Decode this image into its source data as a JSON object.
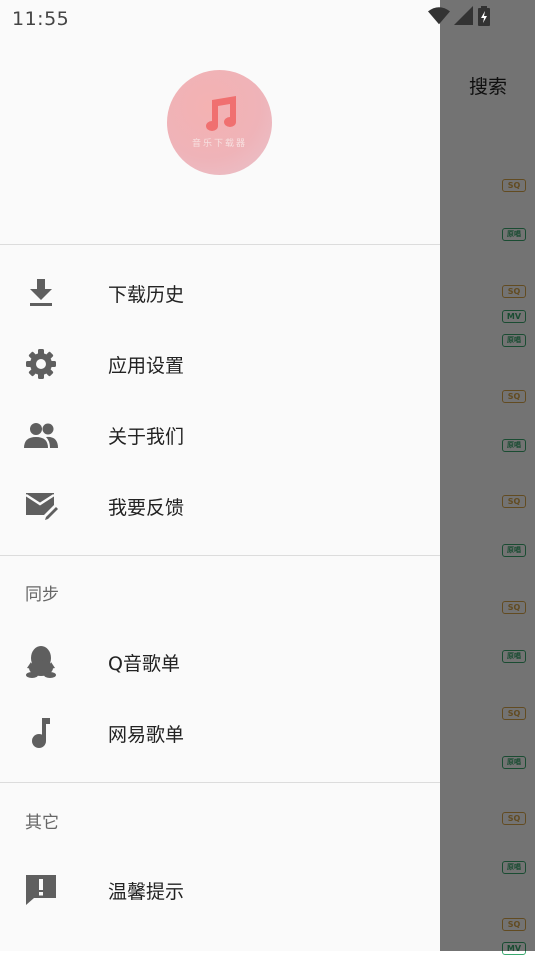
{
  "status_bar": {
    "time": "11:55"
  },
  "background_page": {
    "search_label": "搜索",
    "badges": [
      {
        "type": "sq",
        "text": "SQ"
      },
      {
        "type": "yc",
        "text": "原唱"
      },
      {
        "type": "sq",
        "text": "SQ"
      },
      {
        "type": "mv",
        "text": "MV"
      },
      {
        "type": "yc",
        "text": "原唱"
      },
      {
        "type": "sq",
        "text": "SQ"
      },
      {
        "type": "yc",
        "text": "原唱"
      },
      {
        "type": "sq",
        "text": "SQ"
      },
      {
        "type": "yc",
        "text": "原唱"
      },
      {
        "type": "sq",
        "text": "SQ"
      },
      {
        "type": "yc",
        "text": "原唱"
      },
      {
        "type": "sq",
        "text": "SQ"
      },
      {
        "type": "yc",
        "text": "原唱"
      },
      {
        "type": "sq",
        "text": "SQ"
      },
      {
        "type": "yc",
        "text": "原唱"
      },
      {
        "type": "sq",
        "text": "SQ"
      },
      {
        "type": "mv",
        "text": "MV"
      }
    ]
  },
  "drawer": {
    "logo_text": "音乐下载器",
    "menu": [
      {
        "label": "下载历史",
        "icon": "download-icon"
      },
      {
        "label": "应用设置",
        "icon": "gear-icon"
      },
      {
        "label": "关于我们",
        "icon": "people-icon"
      },
      {
        "label": "我要反馈",
        "icon": "feedback-mail-icon"
      }
    ],
    "sync_section": {
      "title": "同步",
      "items": [
        {
          "label": "Q音歌单",
          "icon": "qq-penguin-icon"
        },
        {
          "label": "网易歌单",
          "icon": "music-note-icon"
        }
      ]
    },
    "other_section": {
      "title": "其它",
      "items": [
        {
          "label": "温馨提示",
          "icon": "alert-message-icon"
        }
      ]
    }
  },
  "colors": {
    "drawer_bg": "#fafafa",
    "icon_gray": "#5f5f5f",
    "logo_pink": "#f2b3b5",
    "badge_gold": "#d9a74a",
    "badge_green": "#3aa86f"
  }
}
